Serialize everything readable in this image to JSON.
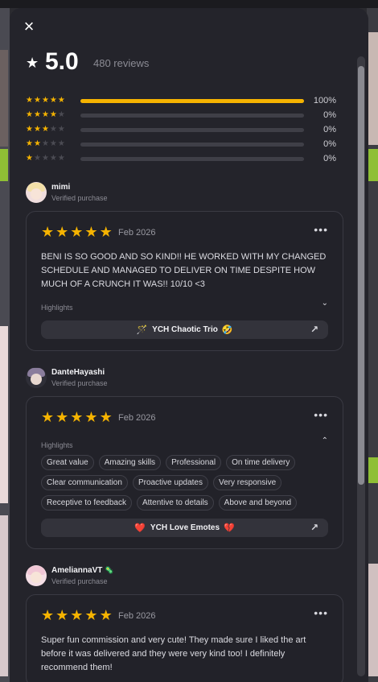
{
  "modal": {
    "close_icon": "×"
  },
  "summary": {
    "score": "5.0",
    "star": "★",
    "reviews_label": "480 reviews"
  },
  "distribution": [
    {
      "stars": 5,
      "fraction": 1.0,
      "percent_label": "100%"
    },
    {
      "stars": 4,
      "fraction": 0.0,
      "percent_label": "0%"
    },
    {
      "stars": 3,
      "fraction": 0.0,
      "percent_label": "0%"
    },
    {
      "stars": 2,
      "fraction": 0.0,
      "percent_label": "0%"
    },
    {
      "stars": 1,
      "fraction": 0.0,
      "percent_label": "0%"
    }
  ],
  "colors": {
    "accent_star": "#f5b301",
    "panel": "#24242b",
    "muted": "#8b8b94"
  },
  "reviews": [
    {
      "name": "mimi",
      "verified": "Verified purchase",
      "rating": 5,
      "date": "Feb 2026",
      "more_icon": "•••",
      "text": "BENI IS SO GOOD AND SO KIND!! HE WORKED WITH MY CHANGED SCHEDULE AND MANAGED TO DELIVER ON TIME DESPITE HOW MUCH OF A CRUNCH IT WAS!! 10/10 <3",
      "highlights_label": "Highlights",
      "highlights_chevron": "⌄",
      "tags": [],
      "product": {
        "label": "YCH Chaotic Trio",
        "emoji_left": "🪄",
        "emoji_right": "🤣",
        "arrow_icon": "↗"
      }
    },
    {
      "name": "DanteHayashi",
      "verified": "Verified purchase",
      "rating": 5,
      "date": "Feb 2026",
      "more_icon": "•••",
      "text": "",
      "highlights_label": "Highlights",
      "highlights_chevron": "⌃",
      "tags": [
        "Great value",
        "Amazing skills",
        "Professional",
        "On time delivery",
        "Clear communication",
        "Proactive updates",
        "Very responsive",
        "Receptive to feedback",
        "Attentive to details",
        "Above and beyond"
      ],
      "product": {
        "label": "YCH Love Emotes",
        "emoji_left": "❤️",
        "emoji_right": "💔",
        "arrow_icon": "↗"
      }
    },
    {
      "name": "AmeliannaVT",
      "name_badge": "🦠",
      "verified": "Verified purchase",
      "rating": 5,
      "date": "Feb 2026",
      "more_icon": "•••",
      "text": "Super fun commission and very cute! They made sure I liked the art before it was delivered and they were very kind too! I definitely recommend them!"
    }
  ]
}
